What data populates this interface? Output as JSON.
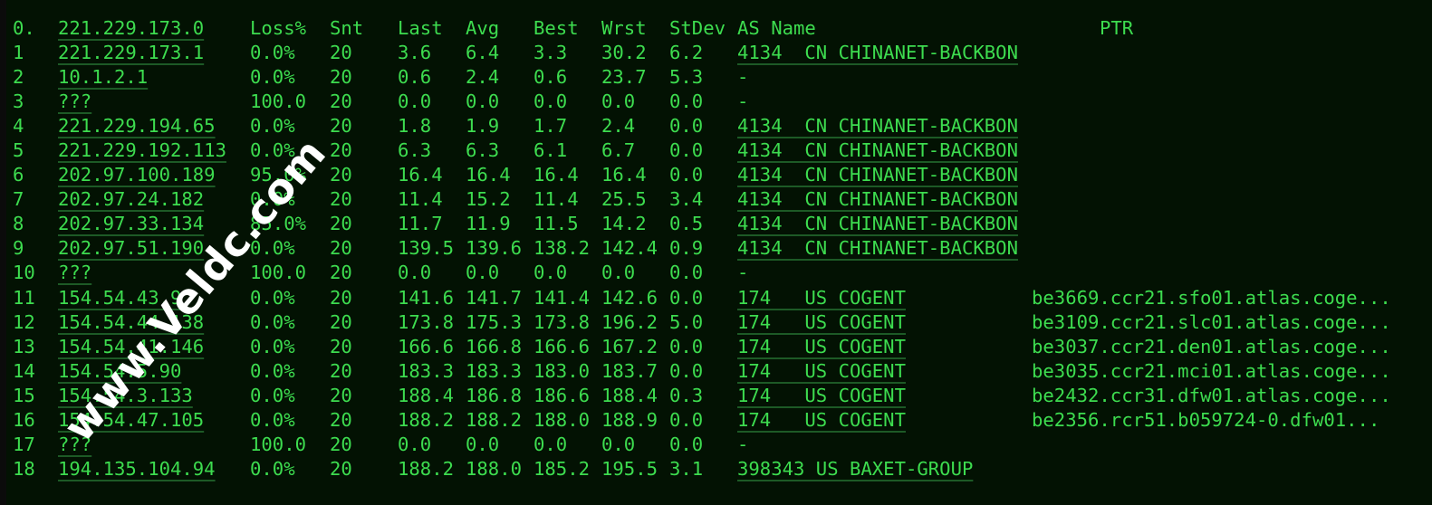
{
  "header": {
    "hop": "0.",
    "ip": "221.229.173.0",
    "loss": "Loss%",
    "snt": "Snt",
    "last": "Last",
    "avg": "Avg",
    "best": "Best",
    "wrst": "Wrst",
    "stdev": "StDev",
    "as": "AS Name",
    "ptr": "PTR"
  },
  "rows": [
    {
      "hop": "1",
      "ip": "221.229.173.1",
      "loss": "0.0%",
      "snt": "20",
      "last": "3.6",
      "avg": "6.4",
      "best": "3.3",
      "wrst": "30.2",
      "stdev": "6.2",
      "as": "4134  CN CHINANET-BACKBON",
      "ptr": ""
    },
    {
      "hop": "2",
      "ip": "10.1.2.1",
      "loss": "0.0%",
      "snt": "20",
      "last": "0.6",
      "avg": "2.4",
      "best": "0.6",
      "wrst": "23.7",
      "stdev": "5.3",
      "as": "-",
      "ptr": ""
    },
    {
      "hop": "3",
      "ip": "???",
      "loss": "100.0",
      "snt": "20",
      "last": "0.0",
      "avg": "0.0",
      "best": "0.0",
      "wrst": "0.0",
      "stdev": "0.0",
      "as": "-",
      "ptr": ""
    },
    {
      "hop": "4",
      "ip": "221.229.194.65",
      "loss": "0.0%",
      "snt": "20",
      "last": "1.8",
      "avg": "1.9",
      "best": "1.7",
      "wrst": "2.4",
      "stdev": "0.0",
      "as": "4134  CN CHINANET-BACKBON",
      "ptr": ""
    },
    {
      "hop": "5",
      "ip": "221.229.192.113",
      "loss": "0.0%",
      "snt": "20",
      "last": "6.3",
      "avg": "6.3",
      "best": "6.1",
      "wrst": "6.7",
      "stdev": "0.0",
      "as": "4134  CN CHINANET-BACKBON",
      "ptr": ""
    },
    {
      "hop": "6",
      "ip": "202.97.100.189",
      "loss": "95.0%",
      "snt": "20",
      "last": "16.4",
      "avg": "16.4",
      "best": "16.4",
      "wrst": "16.4",
      "stdev": "0.0",
      "as": "4134  CN CHINANET-BACKBON",
      "ptr": ""
    },
    {
      "hop": "7",
      "ip": "202.97.24.182",
      "loss": "0.0%",
      "snt": "20",
      "last": "11.4",
      "avg": "15.2",
      "best": "11.4",
      "wrst": "25.5",
      "stdev": "3.4",
      "as": "4134  CN CHINANET-BACKBON",
      "ptr": ""
    },
    {
      "hop": "8",
      "ip": "202.97.33.134",
      "loss": "85.0%",
      "snt": "20",
      "last": "11.7",
      "avg": "11.9",
      "best": "11.5",
      "wrst": "14.2",
      "stdev": "0.5",
      "as": "4134  CN CHINANET-BACKBON",
      "ptr": ""
    },
    {
      "hop": "9",
      "ip": "202.97.51.190",
      "loss": "0.0%",
      "snt": "20",
      "last": "139.5",
      "avg": "139.6",
      "best": "138.2",
      "wrst": "142.4",
      "stdev": "0.9",
      "as": "4134  CN CHINANET-BACKBON",
      "ptr": ""
    },
    {
      "hop": "10",
      "ip": "???",
      "loss": "100.0",
      "snt": "20",
      "last": "0.0",
      "avg": "0.0",
      "best": "0.0",
      "wrst": "0.0",
      "stdev": "0.0",
      "as": "-",
      "ptr": ""
    },
    {
      "hop": "11",
      "ip": "154.54.43.9",
      "loss": "0.0%",
      "snt": "20",
      "last": "141.6",
      "avg": "141.7",
      "best": "141.4",
      "wrst": "142.6",
      "stdev": "0.0",
      "as": "174   US COGENT",
      "ptr": "be3669.ccr21.sfo01.atlas.coge..."
    },
    {
      "hop": "12",
      "ip": "154.54.44.138",
      "loss": "0.0%",
      "snt": "20",
      "last": "173.8",
      "avg": "175.3",
      "best": "173.8",
      "wrst": "196.2",
      "stdev": "5.0",
      "as": "174   US COGENT",
      "ptr": "be3109.ccr21.slc01.atlas.coge..."
    },
    {
      "hop": "13",
      "ip": "154.54.41.146",
      "loss": "0.0%",
      "snt": "20",
      "last": "166.6",
      "avg": "166.8",
      "best": "166.6",
      "wrst": "167.2",
      "stdev": "0.0",
      "as": "174   US COGENT",
      "ptr": "be3037.ccr21.den01.atlas.coge..."
    },
    {
      "hop": "14",
      "ip": "154.54.5.90",
      "loss": "0.0%",
      "snt": "20",
      "last": "183.3",
      "avg": "183.3",
      "best": "183.0",
      "wrst": "183.7",
      "stdev": "0.0",
      "as": "174   US COGENT",
      "ptr": "be3035.ccr21.mci01.atlas.coge..."
    },
    {
      "hop": "15",
      "ip": "154.54.3.133",
      "loss": "0.0%",
      "snt": "20",
      "last": "188.4",
      "avg": "186.8",
      "best": "186.6",
      "wrst": "188.4",
      "stdev": "0.3",
      "as": "174   US COGENT",
      "ptr": "be2432.ccr31.dfw01.atlas.coge..."
    },
    {
      "hop": "16",
      "ip": "154.54.47.105",
      "loss": "0.0%",
      "snt": "20",
      "last": "188.2",
      "avg": "188.2",
      "best": "188.0",
      "wrst": "188.9",
      "stdev": "0.0",
      "as": "174   US COGENT",
      "ptr": "be2356.rcr51.b059724-0.dfw01..."
    },
    {
      "hop": "17",
      "ip": "???",
      "loss": "100.0",
      "snt": "20",
      "last": "0.0",
      "avg": "0.0",
      "best": "0.0",
      "wrst": "0.0",
      "stdev": "0.0",
      "as": "-",
      "ptr": ""
    },
    {
      "hop": "18",
      "ip": "194.135.104.94",
      "loss": "0.0%",
      "snt": "20",
      "last": "188.2",
      "avg": "188.0",
      "best": "185.2",
      "wrst": "195.5",
      "stdev": "3.1",
      "as": "398343 US BAXET-GROUP",
      "ptr": ""
    }
  ],
  "watermark": "www.Veldc.com",
  "colors": {
    "background": "#031203",
    "text": "#3ddc4f",
    "underline": "#1d5a26"
  }
}
